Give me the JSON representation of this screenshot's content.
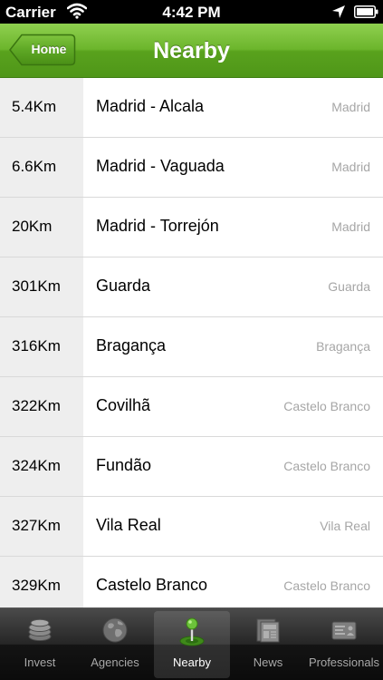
{
  "status_bar": {
    "carrier": "Carrier",
    "time": "4:42 PM",
    "icons": [
      "wifi-icon",
      "location-icon",
      "battery-icon"
    ]
  },
  "nav": {
    "title": "Nearby",
    "back_label": "Home",
    "bar_color": "#6cb52c"
  },
  "list": {
    "rows": [
      {
        "distance": "5.4Km",
        "name": "Madrid - Alcala",
        "region": "Madrid"
      },
      {
        "distance": "6.6Km",
        "name": "Madrid - Vaguada",
        "region": "Madrid"
      },
      {
        "distance": "20Km",
        "name": "Madrid - Torrejón",
        "region": "Madrid"
      },
      {
        "distance": "301Km",
        "name": "Guarda",
        "region": "Guarda"
      },
      {
        "distance": "316Km",
        "name": "Bragança",
        "region": "Bragança"
      },
      {
        "distance": "322Km",
        "name": "Covilhã",
        "region": "Castelo Branco"
      },
      {
        "distance": "324Km",
        "name": "Fundão",
        "region": "Castelo Branco"
      },
      {
        "distance": "327Km",
        "name": "Vila Real",
        "region": "Vila Real"
      },
      {
        "distance": "329Km",
        "name": "Castelo Branco",
        "region": "Castelo Branco"
      }
    ]
  },
  "tab_bar": {
    "selected": "Nearby",
    "tabs": [
      {
        "label": "Invest",
        "icon": "coins-icon"
      },
      {
        "label": "Agencies",
        "icon": "globe-icon"
      },
      {
        "label": "Nearby",
        "icon": "location-pin-icon"
      },
      {
        "label": "News",
        "icon": "newspaper-icon"
      },
      {
        "label": "Professionals",
        "icon": "id-card-icon"
      }
    ]
  }
}
